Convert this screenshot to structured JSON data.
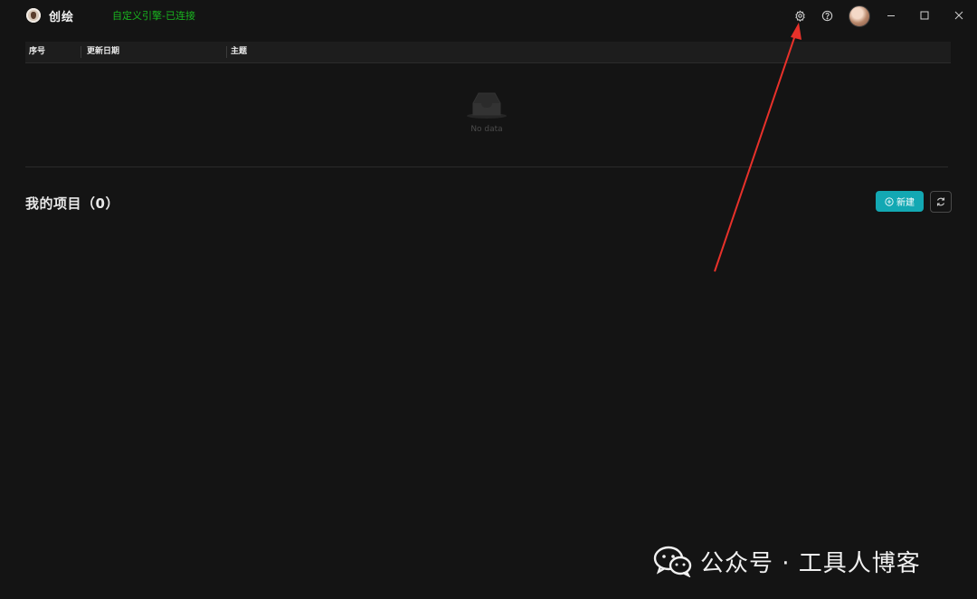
{
  "titlebar": {
    "app_name": "创绘",
    "engine_status": "自定义引擎-已连接",
    "engine_status_color": "#19b41f",
    "icons": [
      "settings-icon",
      "help-icon",
      "avatar",
      "minimize-icon",
      "maximize-icon",
      "close-icon"
    ]
  },
  "table": {
    "columns": [
      "序号",
      "更新日期",
      "主题"
    ],
    "rows": [],
    "empty_text": "No data"
  },
  "projects": {
    "title": "我的项目（0）",
    "new_button_label": "新建",
    "accent_color": "#13a8b3"
  },
  "watermark": {
    "text": "公众号 · 工具人博客"
  }
}
